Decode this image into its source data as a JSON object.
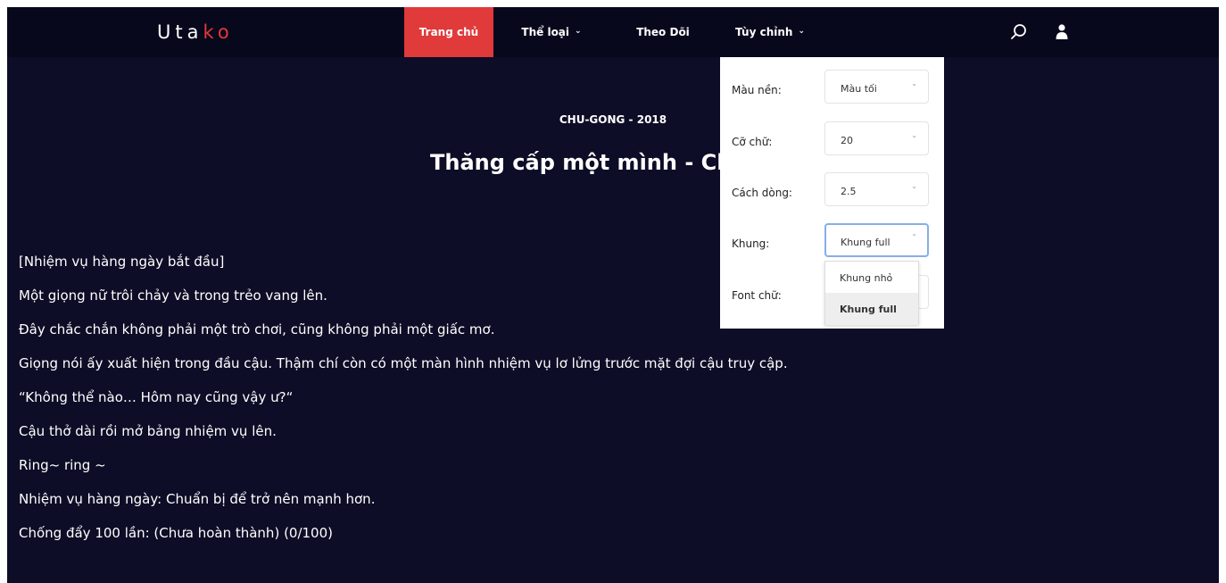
{
  "logo": {
    "text_main": "Uta",
    "text_accent": "ko"
  },
  "nav": {
    "home": "Trang chủ",
    "genre": "Thể loại",
    "follow": "Theo Dõi",
    "customize": "Tùy chỉnh"
  },
  "icons": {
    "search": "search-icon",
    "user": "user-icon",
    "caret": "chevron-down-icon"
  },
  "story": {
    "meta": "CHU-GONG - 2018",
    "title": "Thăng cấp một mình - Ch"
  },
  "content": [
    "[Nhiệm vụ hàng ngày bắt đầu]",
    "Một giọng nữ trôi chảy và trong trẻo vang lên.",
    "Đây chắc chắn không phải một trò chơi, cũng không phải một giấc mơ.",
    "Giọng nói ấy xuất hiện trong đầu cậu. Thậm chí còn có một màn hình nhiệm vụ lơ lửng trước mặt đợi cậu truy cập.",
    "“Không thể nào… Hôm nay cũng vậy ư?“",
    "Cậu thở dài rồi mở bảng nhiệm vụ lên.",
    "Ring~ ring ~",
    "Nhiệm vụ hàng ngày: Chuẩn bị để trở nên mạnh hơn.",
    "Chống đẩy 100 lần: (Chưa hoàn thành) (0/100)"
  ],
  "settings": {
    "background": {
      "label": "Màu nền:",
      "value": "Màu tối"
    },
    "font_size": {
      "label": "Cỡ chữ:",
      "value": "20"
    },
    "line_height": {
      "label": "Cách dòng:",
      "value": "2.5"
    },
    "frame": {
      "label": "Khung:",
      "value": "Khung full",
      "options": [
        "Khung nhỏ",
        "Khung full"
      ]
    },
    "font": {
      "label": "Font chữ:"
    }
  },
  "colors": {
    "page_bg": "#0d0d27",
    "navbar_bg": "#08081c",
    "accent": "#e03a3a",
    "focus_border": "#87aee8"
  }
}
